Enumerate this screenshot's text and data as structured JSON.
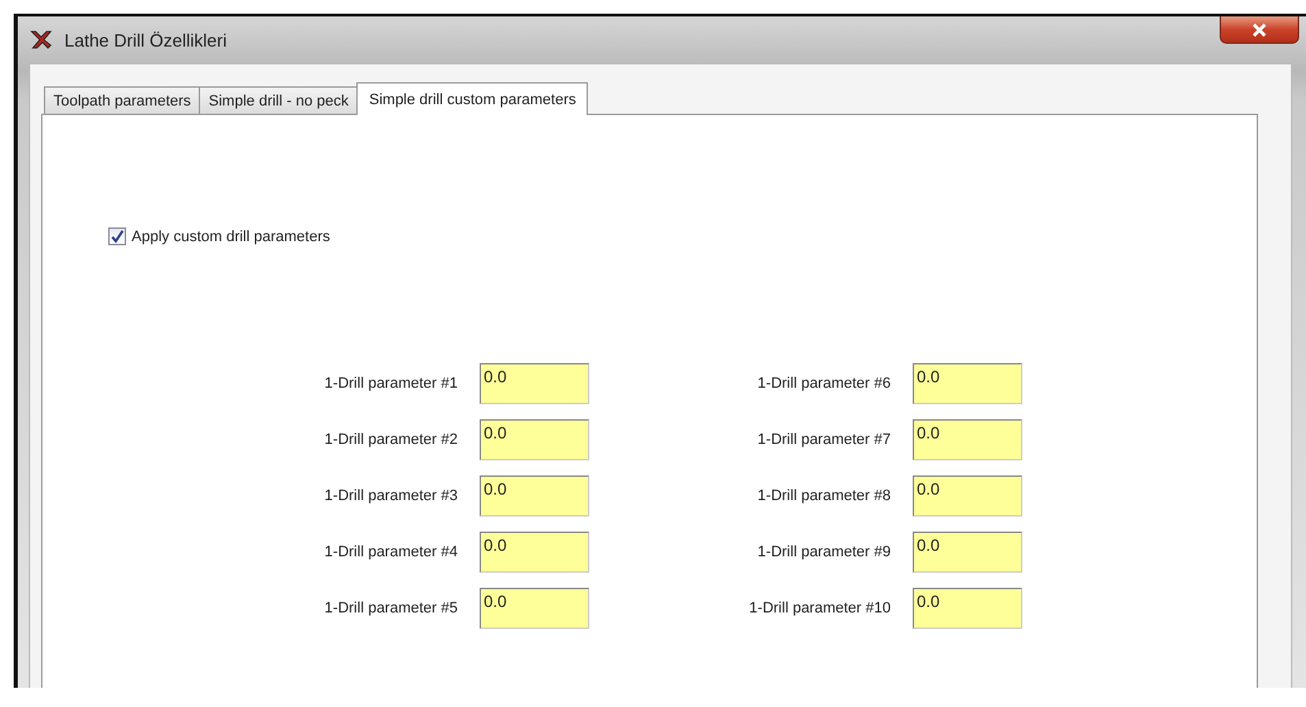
{
  "window": {
    "title": "Lathe Drill Özellikleri"
  },
  "tabs": [
    {
      "label": "Toolpath parameters",
      "selected": false
    },
    {
      "label": "Simple drill - no peck",
      "selected": false
    },
    {
      "label": "Simple drill custom parameters",
      "selected": true
    }
  ],
  "apply_custom": {
    "label": "Apply custom drill parameters",
    "checked": true
  },
  "parameters": [
    {
      "label": "1-Drill parameter #1",
      "value": "0.0"
    },
    {
      "label": "1-Drill parameter #2",
      "value": "0.0"
    },
    {
      "label": "1-Drill parameter #3",
      "value": "0.0"
    },
    {
      "label": "1-Drill parameter #4",
      "value": "0.0"
    },
    {
      "label": "1-Drill parameter #5",
      "value": "0.0"
    },
    {
      "label": "1-Drill parameter #6",
      "value": "0.0"
    },
    {
      "label": "1-Drill parameter #7",
      "value": "0.0"
    },
    {
      "label": "1-Drill parameter #8",
      "value": "0.0"
    },
    {
      "label": "1-Drill parameter #9",
      "value": "0.0"
    },
    {
      "label": "1-Drill parameter #10",
      "value": "0.0"
    }
  ]
}
